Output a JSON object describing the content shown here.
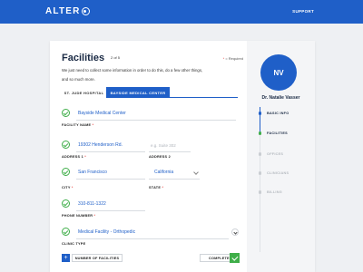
{
  "header": {
    "logo": "ALTER",
    "support": "SUPPORT"
  },
  "form": {
    "title": "Facilities",
    "step": "2 of 5",
    "required_label": "= Required",
    "intro_line1": "We just need to collect some information in order to do this, do a few other things,",
    "intro_line2": "and so much more.",
    "tabs": [
      {
        "label": "ST. JUDE HOSPITAL",
        "active": false
      },
      {
        "label": "BAYSIDE MEDICAL CENTER",
        "active": true
      }
    ],
    "facility_name": {
      "value": "Bayside Medical Center",
      "label": "FACILITY NAME"
    },
    "address1": {
      "value": "19302 Henderson Rd.",
      "label": "ADDRESS 1"
    },
    "address2": {
      "placeholder": "e.g. Suite 302",
      "label": "ADDRESS 2"
    },
    "city": {
      "value": "San Francisco",
      "label": "CITY"
    },
    "state": {
      "value": "California",
      "label": "STATE"
    },
    "phone": {
      "value": "310-811-1322",
      "label": "PHONE NUMBER"
    },
    "clinic_type": {
      "value": "Medical Facility - Orthopedic",
      "label": "CLINIC TYPE"
    },
    "required_mark": "*"
  },
  "bottom": {
    "add_symbol": "+",
    "number_of_facilities": "NUMBER OF FACILITIES",
    "complete": "COMPLETE"
  },
  "sidebar": {
    "initials": "NV",
    "name": "Dr. Natalie Vasser",
    "steps": [
      {
        "label": "BASIC INFO",
        "state": "done"
      },
      {
        "label": "FACILITIES",
        "state": "current"
      },
      {
        "label": "OFFICES",
        "state": "upcoming"
      },
      {
        "label": "CLINICIANS",
        "state": "upcoming"
      },
      {
        "label": "BILLING",
        "state": "upcoming"
      }
    ]
  },
  "colors": {
    "brand_blue": "#1f5fc8",
    "success_green": "#3fae49",
    "required_red": "#e53935"
  }
}
